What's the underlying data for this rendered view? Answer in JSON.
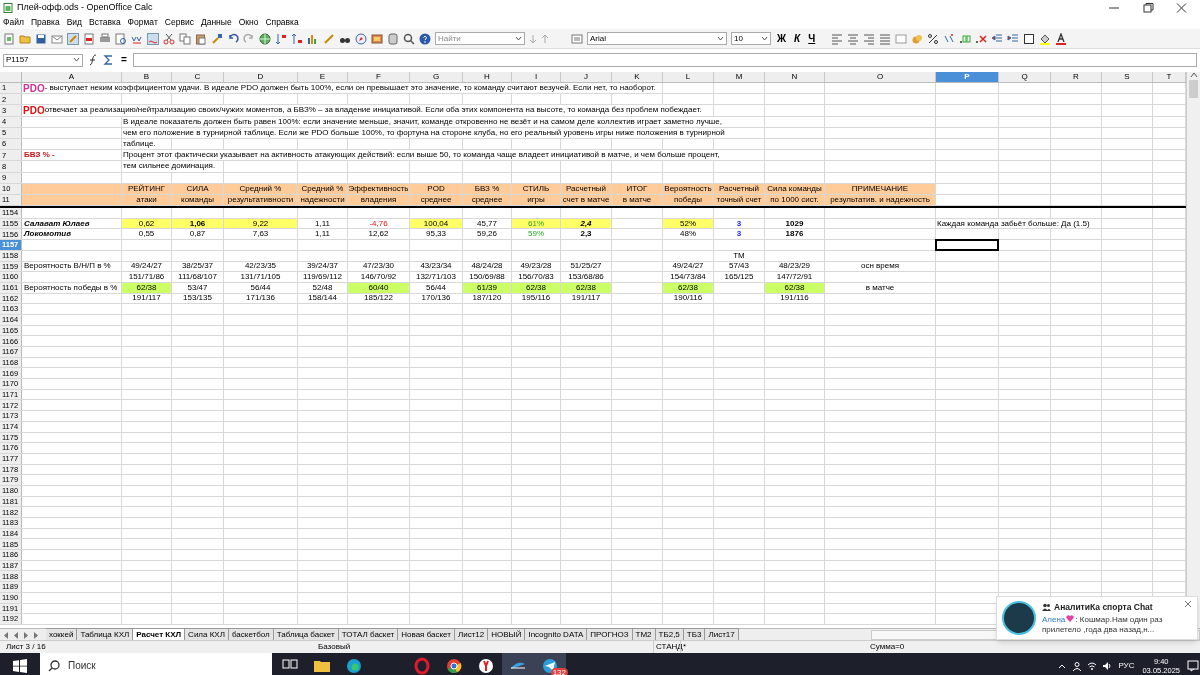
{
  "window": {
    "title": "Плей-офф.ods - OpenOffice Calc"
  },
  "menu": [
    "Файл",
    "Правка",
    "Вид",
    "Вставка",
    "Формат",
    "Сервис",
    "Данные",
    "Окно",
    "Справка"
  ],
  "toolbar": {
    "find_placeholder": "Найти",
    "font": "Arial",
    "size": "10",
    "format_buttons": [
      {
        "label": "Ж",
        "kind": "bold"
      },
      {
        "label": "К",
        "kind": "italic"
      },
      {
        "label": "Ч",
        "kind": "underline"
      }
    ]
  },
  "formula_bar": {
    "cell_ref": "P1157",
    "equals": "="
  },
  "columns": [
    {
      "label": "A",
      "selected": false
    },
    {
      "label": "B",
      "selected": false
    },
    {
      "label": "C",
      "selected": false
    },
    {
      "label": "D",
      "selected": false
    },
    {
      "label": "E",
      "selected": false
    },
    {
      "label": "F",
      "selected": false
    },
    {
      "label": "G",
      "selected": false
    },
    {
      "label": "H",
      "selected": false
    },
    {
      "label": "I",
      "selected": false
    },
    {
      "label": "J",
      "selected": false
    },
    {
      "label": "K",
      "selected": false
    },
    {
      "label": "L",
      "selected": false
    },
    {
      "label": "M",
      "selected": false
    },
    {
      "label": "N",
      "selected": false
    },
    {
      "label": "O",
      "selected": false
    },
    {
      "label": "P",
      "selected": true
    },
    {
      "label": "Q",
      "selected": false
    },
    {
      "label": "R",
      "selected": false
    },
    {
      "label": "S",
      "selected": false
    },
    {
      "label": "T",
      "selected": false
    }
  ],
  "frozen_rows": [
    {
      "number": "1",
      "selected": false,
      "cells": [
        {
          "kind": "note",
          "lead": {
            "text": "PDO",
            "color": "#cc3399"
          },
          "text": " - выступает неким коэффициентом удачи. В идеале PDO должен быть 100%, если он превышает это значение, то команду считают везучей. Если нет, то наоборот."
        }
      ]
    },
    {
      "number": "2",
      "selected": false,
      "cells": []
    },
    {
      "number": "3",
      "selected": false,
      "cells": [
        {
          "kind": "note",
          "lead": {
            "text": "PDO",
            "color": "#dd1111"
          },
          "text": " отвечает за реализацию/нейтрализацию своих/чужих моментов, а БВЗ% – за владение инициативой. Если оба этих компонента на высоте, то команда без проблем побеждает."
        }
      ]
    },
    {
      "number": "4",
      "selected": false,
      "cells": [
        null,
        {
          "kind": "note",
          "text": "В идеале показатель должен быть равен 100%: если значение меньше, значит, команде откровенно не везёт и на самом деле коллектив играет заметно лучше,"
        }
      ]
    },
    {
      "number": "5",
      "selected": false,
      "cells": [
        null,
        {
          "kind": "note",
          "text": "чем его положение в турнирной таблице. Если же PDO больше 100%, то фортуна на стороне клуба, но его реальный уровень игры ниже положения в турнирной"
        }
      ]
    },
    {
      "number": "6",
      "selected": false,
      "cells": [
        null,
        {
          "kind": "note",
          "text": "таблице."
        }
      ]
    },
    {
      "number": "7",
      "selected": false,
      "cells": [
        {
          "text": "БВЗ %  -",
          "color": "#cc1111",
          "bold": true
        },
        {
          "kind": "note",
          "text": " Процент этот фактически указывает на активность атакующих действий: если выше 50, то команда чаще владеет инициативой в матче, и чем больше процент,"
        }
      ]
    },
    {
      "number": "8",
      "selected": false,
      "cells": [
        null,
        {
          "kind": "note",
          "text": "тем сильнее доминация."
        }
      ]
    },
    {
      "number": "9",
      "selected": false,
      "cells": []
    },
    {
      "number": "10",
      "selected": false,
      "cells": [
        {
          "background": {
            "color": "#ffcc99"
          }
        },
        {
          "text": "РЕЙТИНГ",
          "background": {
            "color": "#ffcc99"
          }
        },
        {
          "text": "СИЛА",
          "background": {
            "color": "#ffcc99"
          }
        },
        {
          "text": "Средний %",
          "background": {
            "color": "#ffcc99"
          }
        },
        {
          "text": "Средний %",
          "background": {
            "color": "#ffcc99"
          }
        },
        {
          "text": "Эффективность",
          "background": {
            "color": "#ffcc99"
          }
        },
        {
          "text": "POD",
          "background": {
            "color": "#ffcc99"
          }
        },
        {
          "text": "БВЗ %",
          "background": {
            "color": "#ffcc99"
          }
        },
        {
          "text": "СТИЛЬ",
          "background": {
            "color": "#ffcc99"
          }
        },
        {
          "text": "Расчетный",
          "background": {
            "color": "#ffcc99"
          }
        },
        {
          "text": "ИТОГ",
          "background": {
            "color": "#ffcc99"
          }
        },
        {
          "text": "Вероятность",
          "background": {
            "color": "#ffcc99"
          }
        },
        {
          "text": "Расчетный",
          "background": {
            "color": "#ffcc99"
          }
        },
        {
          "text": "Сила команды",
          "background": {
            "color": "#ffcc99"
          }
        },
        {
          "text": "ПРИМЕЧАНИЕ",
          "background": {
            "color": "#ffcc99"
          }
        }
      ]
    },
    {
      "number": "11",
      "selected": false,
      "cells": [
        {
          "background": {
            "color": "#ffcc99"
          }
        },
        {
          "text": "атаки",
          "background": {
            "color": "#ffcc99"
          }
        },
        {
          "text": "команды",
          "background": {
            "color": "#ffcc99"
          }
        },
        {
          "text": "результативности",
          "background": {
            "color": "#ffcc99"
          }
        },
        {
          "text": "надежности",
          "background": {
            "color": "#ffcc99"
          }
        },
        {
          "text": "владения",
          "background": {
            "color": "#ffcc99"
          }
        },
        {
          "text": "среднее",
          "background": {
            "color": "#ffcc99"
          }
        },
        {
          "text": "среднее",
          "background": {
            "color": "#ffcc99"
          }
        },
        {
          "text": "игры",
          "background": {
            "color": "#ffcc99"
          }
        },
        {
          "text": "счет в матче",
          "background": {
            "color": "#ffcc99"
          }
        },
        {
          "text": "в матче",
          "background": {
            "color": "#ffcc99"
          }
        },
        {
          "text": "победы",
          "background": {
            "color": "#ffcc99"
          }
        },
        {
          "text": "точный счет",
          "background": {
            "color": "#ffcc99"
          }
        },
        {
          "text": "по 1000 сист.",
          "background": {
            "color": "#ffcc99"
          }
        },
        {
          "text": "результатив. и надежность",
          "background": {
            "color": "#ffcc99"
          }
        }
      ]
    }
  ],
  "rows": [
    {
      "number": "1154",
      "selected": false,
      "cells": []
    },
    {
      "number": "1155",
      "selected": false,
      "cells": [
        {
          "text": "Салават Юлаев",
          "bold": true,
          "italic": true
        },
        {
          "text": "0,62",
          "background": {
            "color": "#ffff66"
          }
        },
        {
          "text": "1,06",
          "background": {
            "color": "#ffff66"
          },
          "bold": true
        },
        {
          "text": "9,22",
          "background": {
            "color": "#ffff66"
          }
        },
        {
          "text": "1,11"
        },
        {
          "text": "-4,76",
          "kind": "negative"
        },
        {
          "text": "100,04",
          "background": {
            "color": "#ffff66"
          }
        },
        {
          "text": "45,77"
        },
        {
          "text": "61%",
          "background": {
            "color": "#ffff66"
          },
          "kind": "positive"
        },
        {
          "text": "2,4",
          "background": {
            "color": "#ffff66"
          },
          "bold": true,
          "italic": true
        },
        null,
        {
          "text": "52%",
          "background": {
            "color": "#ffff66"
          }
        },
        {
          "text": "3",
          "kind": "accent",
          "bold": true
        },
        {
          "text": "1029",
          "bold": true
        },
        null,
        {
          "kind": "note",
          "text": "Каждая команда забьёт больше: Да (1.5)"
        }
      ]
    },
    {
      "number": "1156",
      "selected": false,
      "cells": [
        {
          "text": "Локомотив",
          "bold": true,
          "italic": true
        },
        {
          "text": "0,55"
        },
        {
          "text": "0,87"
        },
        {
          "text": "7,63"
        },
        {
          "text": "1,11"
        },
        {
          "text": "12,62"
        },
        {
          "text": "95,33"
        },
        {
          "text": "59,26"
        },
        {
          "text": "59%",
          "kind": "positive"
        },
        {
          "text": "2,3",
          "bold": true
        },
        null,
        {
          "text": "48%"
        },
        {
          "text": "3",
          "kind": "accent",
          "bold": true
        },
        {
          "text": "1876",
          "bold": true
        }
      ]
    },
    {
      "number": "1157",
      "selected": true,
      "cells": []
    },
    {
      "number": "1158",
      "selected": false,
      "cells": [
        null,
        null,
        null,
        null,
        null,
        null,
        null,
        null,
        null,
        null,
        null,
        null,
        {
          "text": "ТМ"
        }
      ]
    },
    {
      "number": "1159",
      "selected": false,
      "cells": [
        {
          "text": "Вероятность В/Н/П в %"
        },
        {
          "text": "49/24/27"
        },
        {
          "text": "38/25/37"
        },
        {
          "text": "42/23/35"
        },
        {
          "text": "39/24/37"
        },
        {
          "text": "47/23/30"
        },
        {
          "text": "43/23/34"
        },
        {
          "text": "48/24/28"
        },
        {
          "text": "49/23/28"
        },
        {
          "text": "51/25/27"
        },
        null,
        {
          "text": "49/24/27"
        },
        {
          "text": "57/43"
        },
        {
          "text": "48/23/29"
        },
        {
          "text": "осн время"
        }
      ]
    },
    {
      "number": "1160",
      "selected": false,
      "cells": [
        null,
        {
          "text": "151/71/86"
        },
        {
          "text": "111/68/107"
        },
        {
          "text": "131/71/105"
        },
        {
          "text": "119/69/112"
        },
        {
          "text": "146/70/92"
        },
        {
          "text": "132/71/103"
        },
        {
          "text": "150/69/88"
        },
        {
          "text": "156/70/83"
        },
        {
          "text": "153/68/86"
        },
        null,
        {
          "text": "154/73/84"
        },
        {
          "text": "165/125"
        },
        {
          "text": "147/72/91"
        }
      ]
    },
    {
      "number": "1161",
      "selected": false,
      "cells": [
        {
          "text": "Вероятность победы в %"
        },
        {
          "text": "62/38",
          "background": {
            "color": "#ccff66"
          }
        },
        {
          "text": "53/47"
        },
        {
          "text": "56/44"
        },
        {
          "text": "52/48"
        },
        {
          "text": "60/40",
          "background": {
            "color": "#ccff66"
          }
        },
        {
          "text": "56/44"
        },
        {
          "text": "61/39",
          "background": {
            "color": "#ccff66"
          }
        },
        {
          "text": "62/38",
          "background": {
            "color": "#ccff66"
          }
        },
        {
          "text": "62/38",
          "background": {
            "color": "#ccff66"
          }
        },
        null,
        {
          "text": "62/38",
          "background": {
            "color": "#ccff66"
          }
        },
        null,
        {
          "text": "62/38",
          "background": {
            "color": "#ccff66"
          }
        },
        {
          "text": "в матче"
        }
      ]
    },
    {
      "number": "1162",
      "selected": false,
      "cells": [
        null,
        {
          "text": "191/117"
        },
        {
          "text": "153/135"
        },
        {
          "text": "171/136"
        },
        {
          "text": "158/144"
        },
        {
          "text": "185/122"
        },
        {
          "text": "170/136"
        },
        {
          "text": "187/120"
        },
        {
          "text": "195/116"
        },
        {
          "text": "191/117"
        },
        null,
        {
          "text": "190/116"
        },
        null,
        {
          "text": "191/116"
        }
      ]
    },
    {
      "number": "1163",
      "selected": false,
      "cells": []
    },
    {
      "number": "1164",
      "selected": false,
      "cells": []
    },
    {
      "number": "1165",
      "selected": false,
      "cells": []
    },
    {
      "number": "1166",
      "selected": false,
      "cells": []
    },
    {
      "number": "1167",
      "selected": false,
      "cells": []
    },
    {
      "number": "1168",
      "selected": false,
      "cells": []
    },
    {
      "number": "1169",
      "selected": false,
      "cells": []
    },
    {
      "number": "1170",
      "selected": false,
      "cells": []
    },
    {
      "number": "1171",
      "selected": false,
      "cells": []
    },
    {
      "number": "1172",
      "selected": false,
      "cells": []
    },
    {
      "number": "1173",
      "selected": false,
      "cells": []
    },
    {
      "number": "1174",
      "selected": false,
      "cells": []
    },
    {
      "number": "1175",
      "selected": false,
      "cells": []
    },
    {
      "number": "1176",
      "selected": false,
      "cells": []
    },
    {
      "number": "1177",
      "selected": false,
      "cells": []
    },
    {
      "number": "1178",
      "selected": false,
      "cells": []
    },
    {
      "number": "1179",
      "selected": false,
      "cells": []
    },
    {
      "number": "1180",
      "selected": false,
      "cells": []
    },
    {
      "number": "1181",
      "selected": false,
      "cells": []
    },
    {
      "number": "1182",
      "selected": false,
      "cells": []
    },
    {
      "number": "1183",
      "selected": false,
      "cells": []
    },
    {
      "number": "1184",
      "selected": false,
      "cells": []
    },
    {
      "number": "1185",
      "selected": false,
      "cells": []
    },
    {
      "number": "1186",
      "selected": false,
      "cells": []
    },
    {
      "number": "1187",
      "selected": false,
      "cells": []
    },
    {
      "number": "1188",
      "selected": false,
      "cells": []
    },
    {
      "number": "1189",
      "selected": false,
      "cells": []
    },
    {
      "number": "1190",
      "selected": false,
      "cells": []
    },
    {
      "number": "1191",
      "selected": false,
      "cells": []
    },
    {
      "number": "1192",
      "selected": false,
      "cells": []
    }
  ],
  "sheet_tabs": [
    {
      "label": "хоккей",
      "selected": false
    },
    {
      "label": "Таблица КХЛ",
      "selected": false
    },
    {
      "label": "Расчет КХЛ",
      "selected": true
    },
    {
      "label": "Сила КХЛ",
      "selected": false
    },
    {
      "label": "баскетбол",
      "selected": false
    },
    {
      "label": "Таблица баскет",
      "selected": false
    },
    {
      "label": "ТОТАЛ баскет",
      "selected": false
    },
    {
      "label": "Новая баскет",
      "selected": false
    },
    {
      "label": "Лист12",
      "selected": false
    },
    {
      "label": "НОВЫЙ",
      "selected": false
    },
    {
      "label": "Incognito DATA",
      "selected": false
    },
    {
      "label": "ПРОГНОЗ",
      "selected": false
    },
    {
      "label": "ТМ2",
      "selected": false
    },
    {
      "label": "ТБ2,5",
      "selected": false
    },
    {
      "label": "ТБ3",
      "selected": false
    },
    {
      "label": "Лист17",
      "selected": false
    }
  ],
  "status_bar": {
    "sheet": "Лист 3 / 16",
    "style": "Базовый",
    "mode": "СТАНД",
    "modified": "*",
    "sum": "Сумма=0"
  },
  "notification": {
    "title": "АналитиКа спорта Chat",
    "sender": "Алена",
    "message": ": Кошмар.Нам один раз прилетело ,года два назад,н..."
  },
  "taskbar": {
    "search_placeholder": "Поиск",
    "telegram_badge": "132",
    "language": "РУС",
    "time": "9:40",
    "date": "03.05.2025"
  }
}
